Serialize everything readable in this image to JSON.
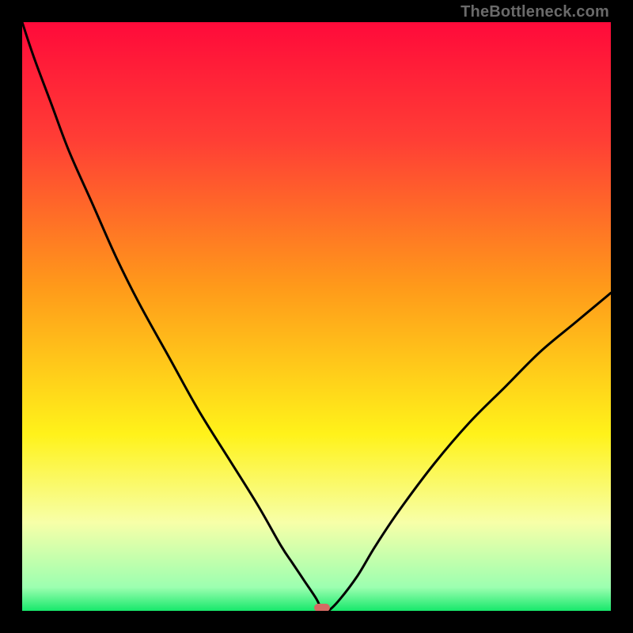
{
  "watermark": "TheBottleneck.com",
  "colors": {
    "frame_border": "#000000",
    "curve": "#000000",
    "marker": "#d46a63",
    "gradient_stops": [
      {
        "pct": 0,
        "color": "#ff0a3a"
      },
      {
        "pct": 20,
        "color": "#ff3e35"
      },
      {
        "pct": 45,
        "color": "#ff9a1a"
      },
      {
        "pct": 70,
        "color": "#fff21a"
      },
      {
        "pct": 85,
        "color": "#f7ffa8"
      },
      {
        "pct": 96,
        "color": "#9cffb0"
      },
      {
        "pct": 100,
        "color": "#17e86b"
      }
    ]
  },
  "chart_data": {
    "type": "line",
    "title": "",
    "xlabel": "",
    "ylabel": "",
    "xlim": [
      0,
      100
    ],
    "ylim": [
      0,
      100
    ],
    "x": [
      0,
      2,
      5,
      8,
      12,
      16,
      20,
      25,
      30,
      35,
      40,
      44,
      46,
      48,
      50,
      51,
      52,
      54,
      57,
      60,
      64,
      70,
      76,
      82,
      88,
      94,
      100
    ],
    "values": [
      100,
      94,
      86,
      78,
      69,
      60,
      52,
      43,
      34,
      26,
      18,
      11,
      8,
      5,
      2,
      0,
      0,
      2,
      6,
      11,
      17,
      25,
      32,
      38,
      44,
      49,
      54
    ],
    "minimum": {
      "x": 51,
      "y": 0
    },
    "note": "V-shaped bottleneck curve; left branch steeper than right; minimum highlighted by marker; background gradient encodes severity (red=high, green=low)."
  }
}
